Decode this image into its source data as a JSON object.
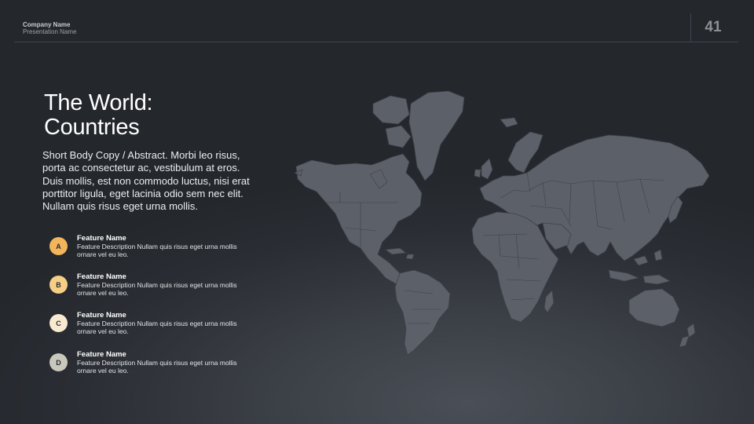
{
  "header": {
    "company_name": "Company Name",
    "presentation_name": "Presentation Name",
    "page_number": "41"
  },
  "slide": {
    "title": "The World:\nCountries",
    "body_copy": "Short Body Copy / Abstract.  Morbi leo risus, porta ac consectetur ac, vestibulum at eros. Duis mollis, est non commodo luctus, nisi erat porttitor ligula, eget lacinia odio sem nec elit. Nullam quis risus eget urna mollis."
  },
  "features": [
    {
      "letter": "A",
      "name": "Feature Name",
      "description": "Feature Description Nullam quis risus eget urna mollis ornare vel eu leo.",
      "color": "#f2b55b"
    },
    {
      "letter": "B",
      "name": "Feature Name",
      "description": "Feature Description Nullam quis risus eget urna mollis ornare vel eu leo.",
      "color": "#f5cf85"
    },
    {
      "letter": "C",
      "name": "Feature Name",
      "description": "Feature Description Nullam quis risus eget urna mollis ornare vel eu leo.",
      "color": "#f8ead0"
    },
    {
      "letter": "D",
      "name": "Feature Name",
      "description": "Feature Description Nullam quis risus eget urna mollis ornare vel eu leo.",
      "color": "#c9c8bd"
    }
  ],
  "map": {
    "icon": "world-map",
    "land_color": "#5c6069",
    "border_color": "#3e4148"
  }
}
